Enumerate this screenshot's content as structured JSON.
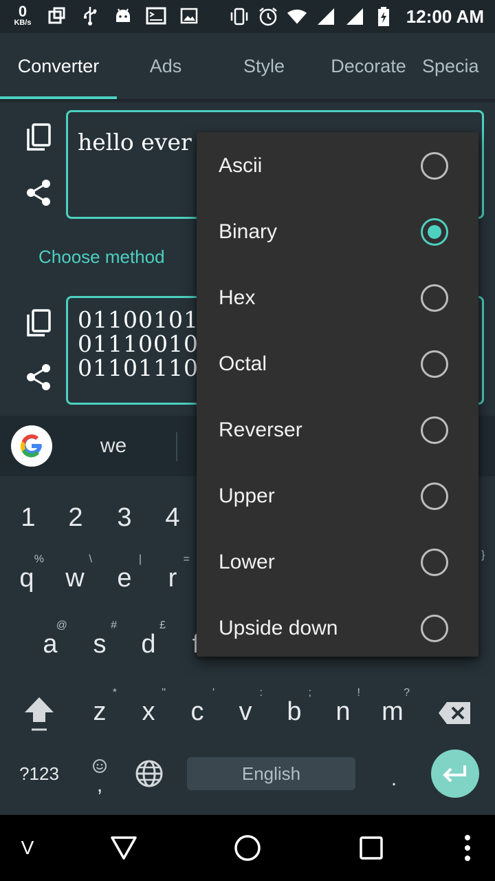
{
  "status_bar": {
    "net_speed_value": "0",
    "net_speed_unit": "KB/s",
    "time": "12:00 AM",
    "icons": [
      "network-speed-icon",
      "screenshot-icon",
      "usb-icon",
      "android-debug-icon",
      "terminal-icon",
      "image-icon",
      "vibrate-icon",
      "alarm-icon",
      "wifi-icon",
      "signal-icon",
      "signal-icon-2",
      "battery-icon"
    ]
  },
  "tabs": [
    {
      "label": "Converter",
      "active": true
    },
    {
      "label": "Ads",
      "active": false
    },
    {
      "label": "Style",
      "active": false
    },
    {
      "label": "Decorate",
      "active": false
    },
    {
      "label": "Specia",
      "active": false
    }
  ],
  "converter": {
    "input_text": "hello ever",
    "choose_method_label": "Choose method",
    "output_lines": [
      "01100101",
      "01110010",
      "01101110"
    ],
    "accent_color": "#4dd0c0"
  },
  "keyboard": {
    "suggestion": "we",
    "number_row": [
      "1",
      "2",
      "3",
      "4"
    ],
    "row1": [
      {
        "key": "q",
        "hint": "%"
      },
      {
        "key": "w",
        "hint": "\\"
      },
      {
        "key": "e",
        "hint": "|"
      },
      {
        "key": "r",
        "hint": "="
      }
    ],
    "row1_far_hint": "}",
    "row2": [
      {
        "key": "a",
        "hint": "@"
      },
      {
        "key": "s",
        "hint": "#"
      },
      {
        "key": "d",
        "hint": "£"
      },
      {
        "key": "f",
        "hint": ""
      }
    ],
    "row3": [
      {
        "key": "z",
        "hint": "*"
      },
      {
        "key": "x",
        "hint": "\""
      },
      {
        "key": "c",
        "hint": "'"
      },
      {
        "key": "v",
        "hint": ":"
      },
      {
        "key": "b",
        "hint": ";"
      },
      {
        "key": "n",
        "hint": "!"
      },
      {
        "key": "m",
        "hint": "?"
      }
    ],
    "symbols_label": "?123",
    "comma_label": ",",
    "space_label": "English",
    "period_label": "."
  },
  "nav_bar": {
    "left_label": "V"
  },
  "method_menu": {
    "items": [
      {
        "label": "Ascii",
        "selected": false
      },
      {
        "label": "Binary",
        "selected": true
      },
      {
        "label": "Hex",
        "selected": false
      },
      {
        "label": "Octal",
        "selected": false
      },
      {
        "label": "Reverser",
        "selected": false
      },
      {
        "label": "Upper",
        "selected": false
      },
      {
        "label": "Lower",
        "selected": false
      },
      {
        "label": "Upside down",
        "selected": false
      }
    ]
  }
}
